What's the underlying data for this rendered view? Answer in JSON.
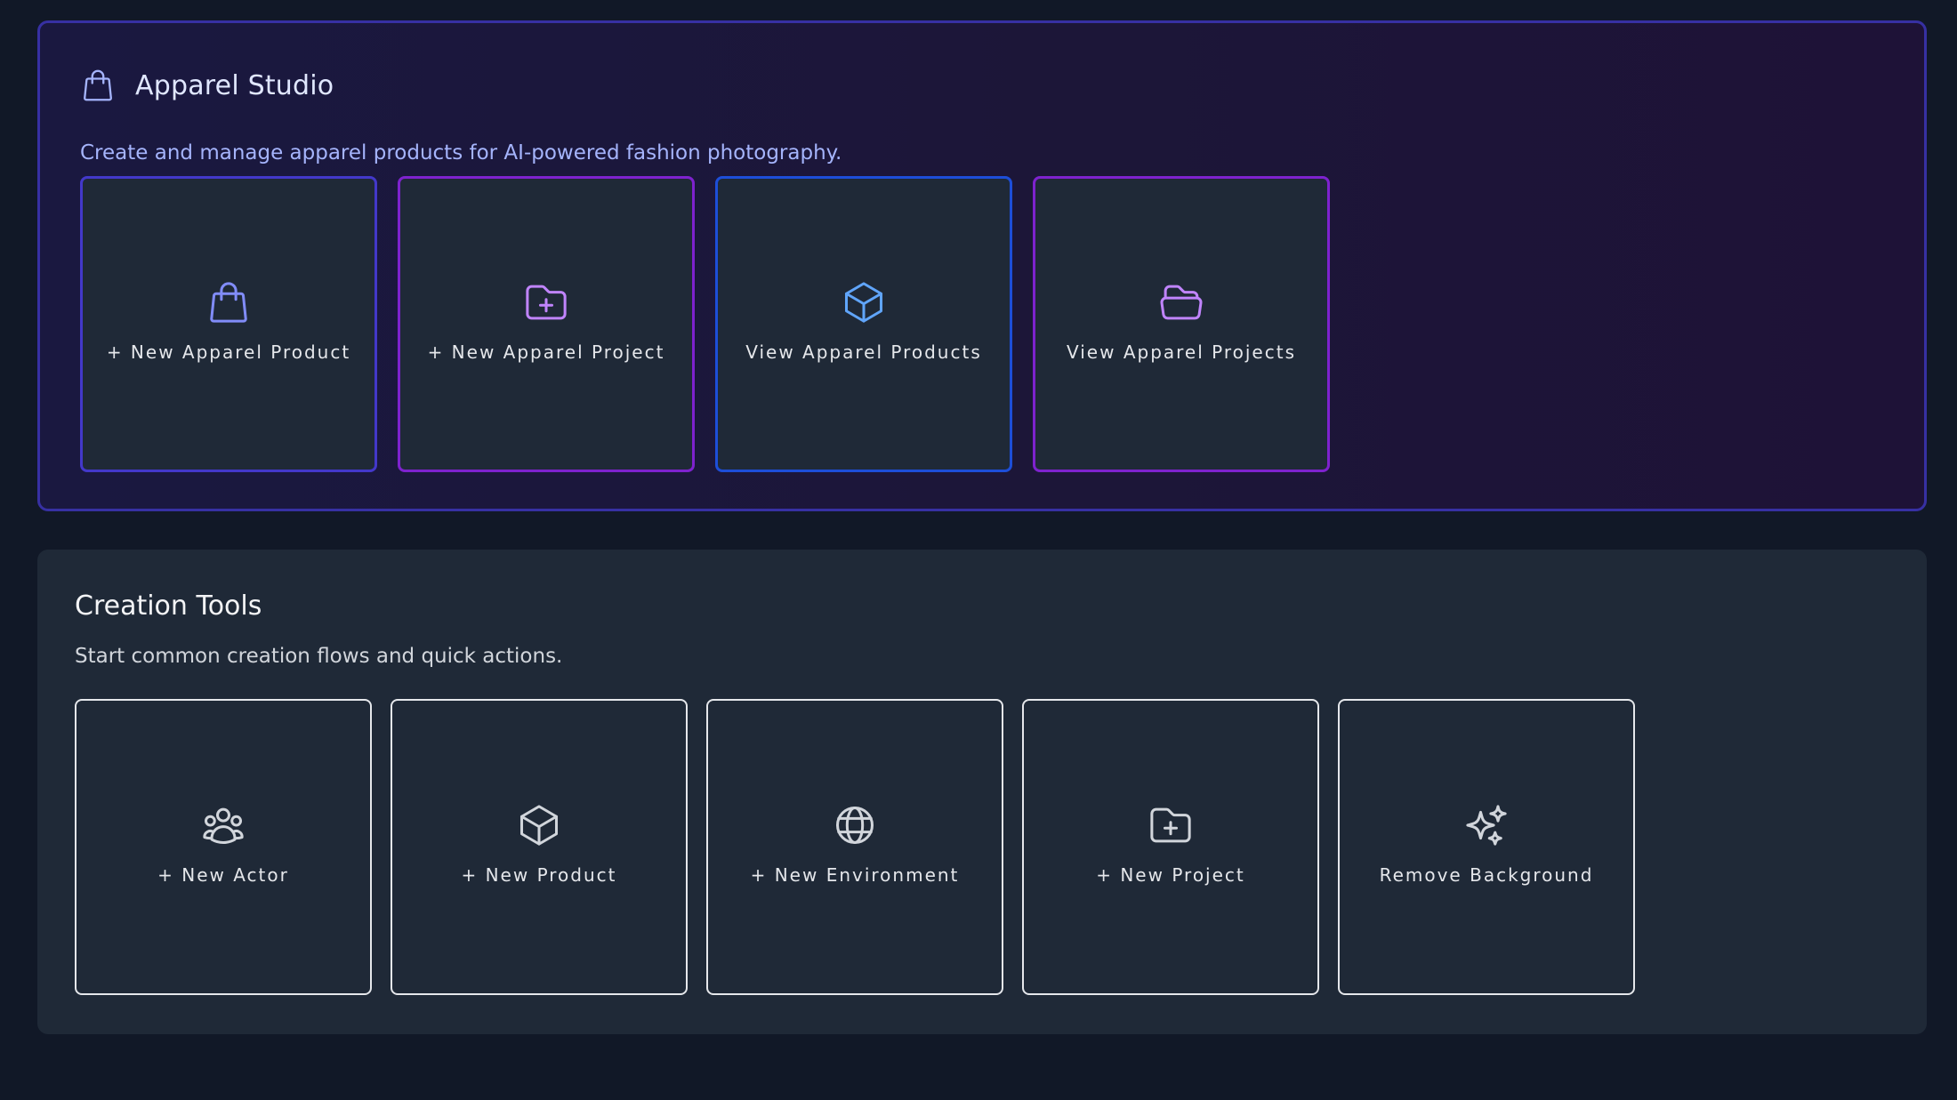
{
  "apparel_studio": {
    "title": "Apparel Studio",
    "description": "Create and manage apparel products for AI-powered fashion photography.",
    "title_icon": "shopping-bag-icon",
    "cards": [
      {
        "label": "+ New Apparel Product",
        "icon": "shopping-bag-icon",
        "accent": "#4338ca"
      },
      {
        "label": "+ New Apparel Project",
        "icon": "folder-plus-icon",
        "accent": "#7e22ce"
      },
      {
        "label": "View Apparel Products",
        "icon": "cube-icon",
        "accent": "#1d4ed8"
      },
      {
        "label": "View Apparel Projects",
        "icon": "folder-open-icon",
        "accent": "#7e22ce"
      }
    ]
  },
  "creation_tools": {
    "title": "Creation Tools",
    "description": "Start common creation flows and quick actions.",
    "cards": [
      {
        "label": "+ New Actor",
        "icon": "users-icon"
      },
      {
        "label": "+ New Product",
        "icon": "cube-icon"
      },
      {
        "label": "+ New Environment",
        "icon": "globe-icon"
      },
      {
        "label": "+ New Project",
        "icon": "folder-plus-icon"
      },
      {
        "label": "Remove Background",
        "icon": "sparkles-icon"
      }
    ]
  }
}
